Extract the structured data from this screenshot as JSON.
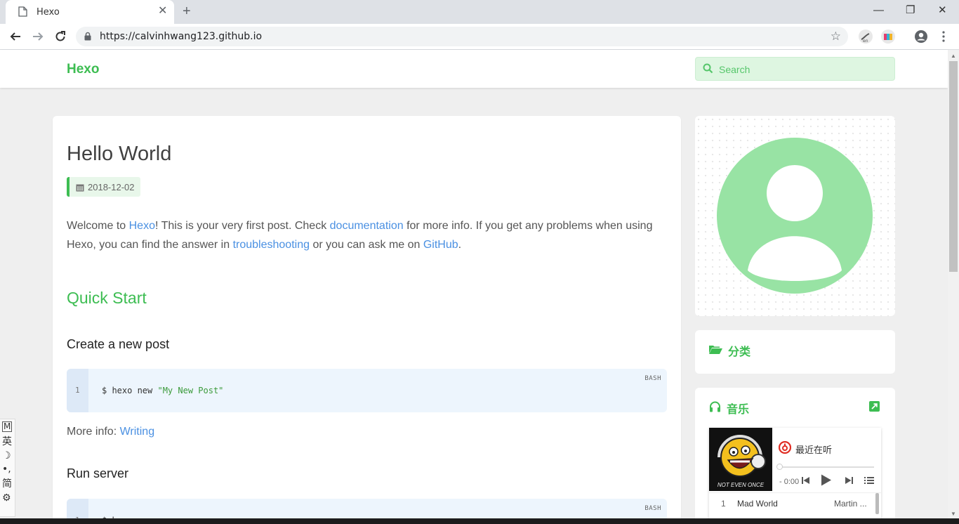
{
  "browser": {
    "tab_title": "Hexo",
    "url": "https://calvinhwang123.github.io",
    "new_tab": "+",
    "close_tab": "✕",
    "minimize": "—",
    "maximize": "❐",
    "close_window": "✕"
  },
  "site": {
    "brand": "Hexo",
    "search_placeholder": "Search"
  },
  "post": {
    "title": "Hello World",
    "date": "2018-12-02",
    "intro_1": "Welcome to ",
    "intro_link_hexo": "Hexo",
    "intro_2": "! This is your very first post. Check ",
    "intro_link_docs": "documentation",
    "intro_3": " for more info. If you get any problems when using Hexo, you can find the answer in ",
    "intro_link_trouble": "troubleshooting",
    "intro_4": " or you can ask me on ",
    "intro_link_github": "GitHub",
    "intro_5": ".",
    "h2_quick_start": "Quick Start",
    "h3_new_post": "Create a new post",
    "code1": {
      "line_number": "1",
      "lang": "BASH",
      "command": "$ hexo new ",
      "string": "\"My New Post\""
    },
    "more_info_label": "More info: ",
    "more_info_link": "Writing",
    "h3_run_server": "Run server",
    "code2": {
      "line_number": "1",
      "lang": "BASH",
      "command": "$ h"
    }
  },
  "sidebar": {
    "categories_title": "分类",
    "music_title": "音乐",
    "player": {
      "title": "最近在听",
      "time": "- 0:00",
      "cover_text": "NOT EVEN ONCE",
      "playlist": [
        {
          "num": "1",
          "title": "Mad World",
          "artist": "Martin ..."
        }
      ]
    }
  },
  "ime": {
    "mode": "M",
    "lang": "英",
    "moon": "☽",
    "punct": "•,",
    "charset": "简",
    "settings": "⚙"
  },
  "colors": {
    "accent": "#3dbd52",
    "link": "#4a90e2",
    "page_bg": "#efefef"
  }
}
